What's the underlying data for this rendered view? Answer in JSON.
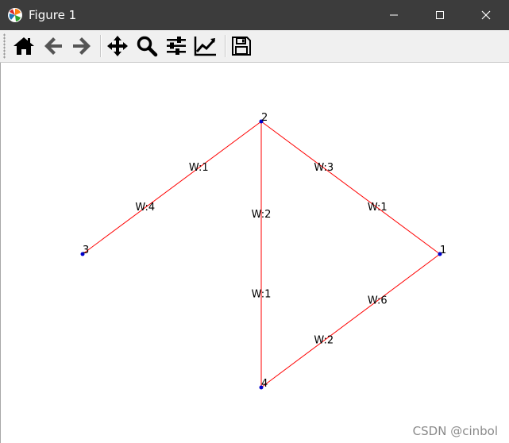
{
  "window": {
    "title": "Figure 1"
  },
  "toolbar": {
    "buttons": [
      {
        "name": "home-button",
        "icon": "home-icon"
      },
      {
        "name": "back-button",
        "icon": "arrow-left-icon"
      },
      {
        "name": "forward-button",
        "icon": "arrow-right-icon"
      },
      {
        "name": "pan-button",
        "icon": "move-icon"
      },
      {
        "name": "zoom-button",
        "icon": "magnifier-icon"
      },
      {
        "name": "configure-subplots-button",
        "icon": "sliders-icon"
      },
      {
        "name": "edit-axis-button",
        "icon": "line-chart-icon"
      },
      {
        "name": "save-button",
        "icon": "floppy-disk-icon"
      }
    ]
  },
  "graph": {
    "node_color": "#0000cc",
    "edge_color": "#ff0000",
    "nodes": [
      {
        "id": "1",
        "label": "1"
      },
      {
        "id": "2",
        "label": "2"
      },
      {
        "id": "3",
        "label": "3"
      },
      {
        "id": "4",
        "label": "4"
      }
    ],
    "edges": [
      {
        "from": "1",
        "to": "2",
        "labels": [
          "W:1",
          "W:3"
        ]
      },
      {
        "from": "2",
        "to": "3",
        "labels": [
          "W:1",
          "W:4"
        ]
      },
      {
        "from": "2",
        "to": "4",
        "labels": [
          "W:2",
          "W:1"
        ]
      },
      {
        "from": "1",
        "to": "4",
        "labels": [
          "W:6",
          "W:2"
        ]
      }
    ]
  },
  "watermark": "CSDN @cinbol"
}
